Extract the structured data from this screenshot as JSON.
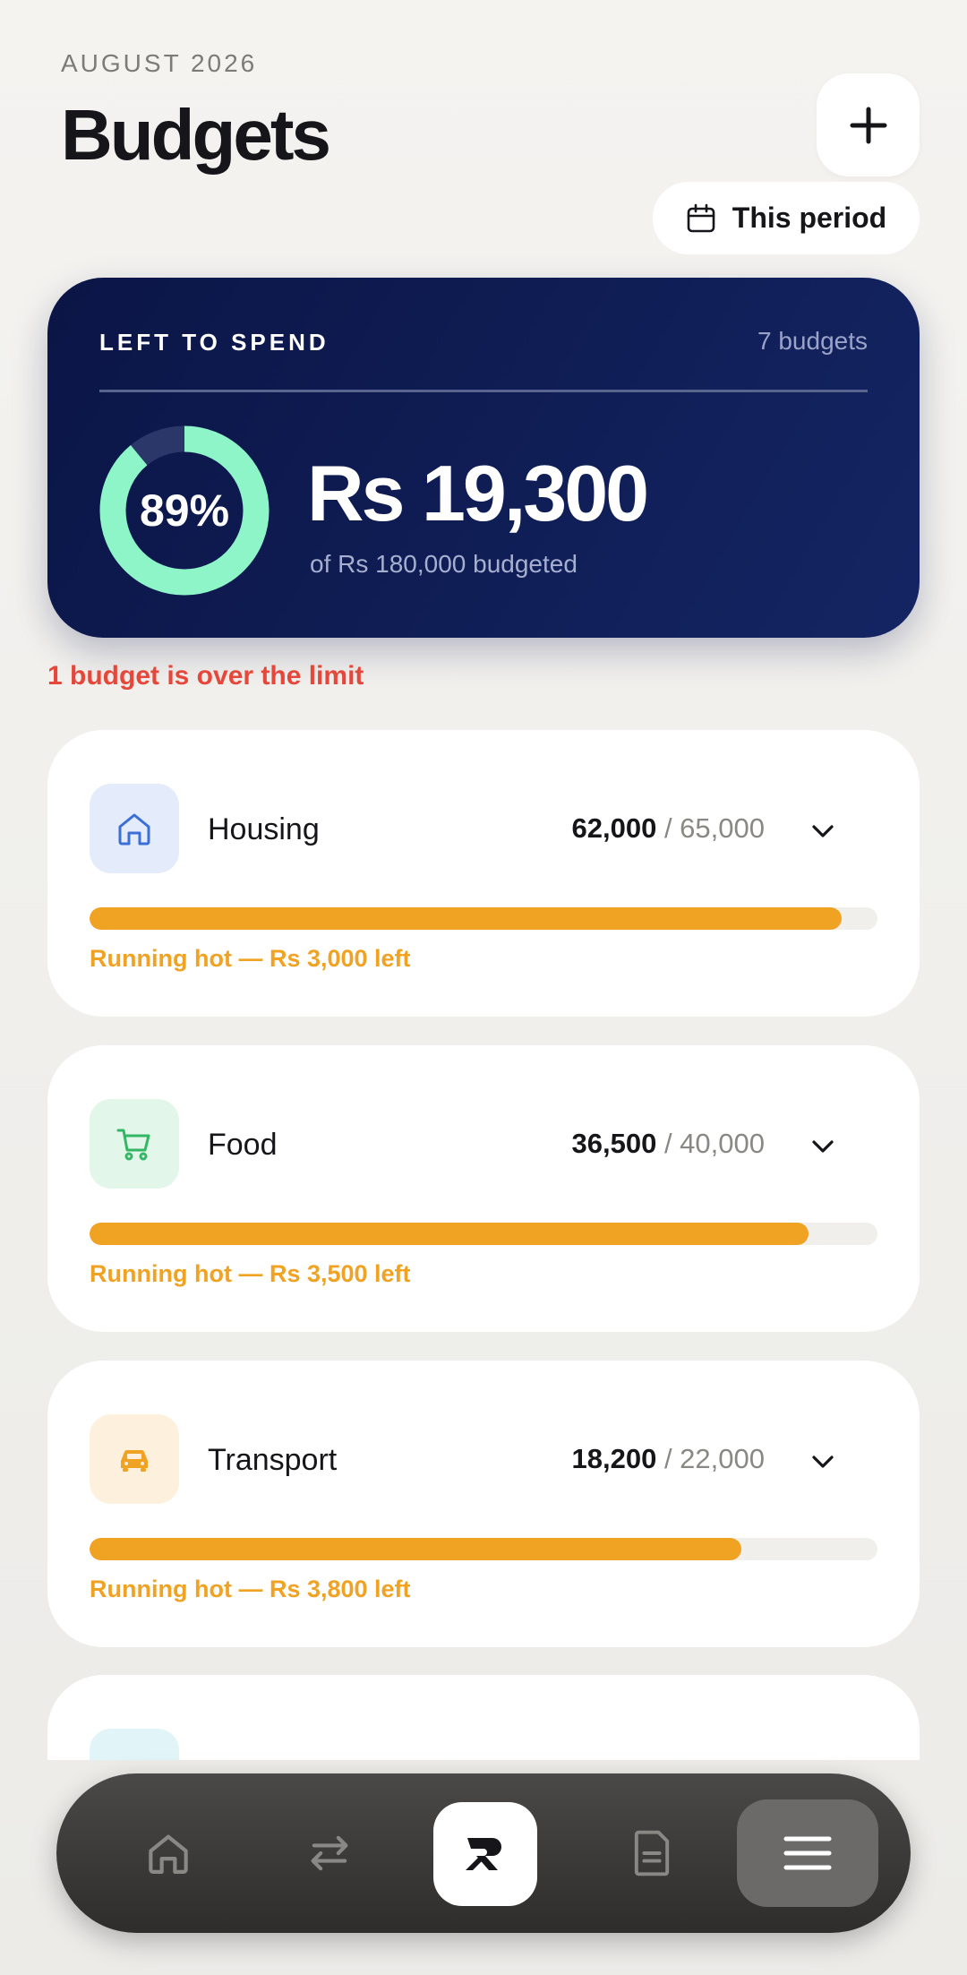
{
  "header": {
    "period": "AUGUST 2026",
    "title": "Budgets",
    "period_button": "This period"
  },
  "summary": {
    "label": "LEFT TO SPEND",
    "count": "7 budgets",
    "percent_text": "89%",
    "percent_value": 0.89,
    "amount": "Rs 19,300",
    "of_text": "of Rs 180,000 budgeted",
    "ring_color": "#8ef5c9"
  },
  "warning": "1 budget is over the limit",
  "budgets": [
    {
      "name": "Housing",
      "spent": "62,000",
      "limit": "/ 65,000",
      "progress": 0.954,
      "status": "Running hot — Rs 3,000 left",
      "icon": "home-icon",
      "icon_bg": "#e4ebfb",
      "icon_color": "#3b6fd8"
    },
    {
      "name": "Food",
      "spent": "36,500",
      "limit": "/ 40,000",
      "progress": 0.9125,
      "status": "Running hot — Rs 3,500 left",
      "icon": "cart-icon",
      "icon_bg": "#e2f6ea",
      "icon_color": "#34b765"
    },
    {
      "name": "Transport",
      "spent": "18,200",
      "limit": "/ 22,000",
      "progress": 0.827,
      "status": "Running hot — Rs 3,800 left",
      "icon": "car-icon",
      "icon_bg": "#fdf0dc",
      "icon_color": "#f0a223"
    }
  ],
  "colors": {
    "accent": "#f0a223",
    "danger": "#e5483a",
    "navy": "#0b1546"
  },
  "nav": {
    "items": [
      "home-icon",
      "transfer-icon",
      "logo-icon",
      "document-icon",
      "menu-icon"
    ]
  }
}
